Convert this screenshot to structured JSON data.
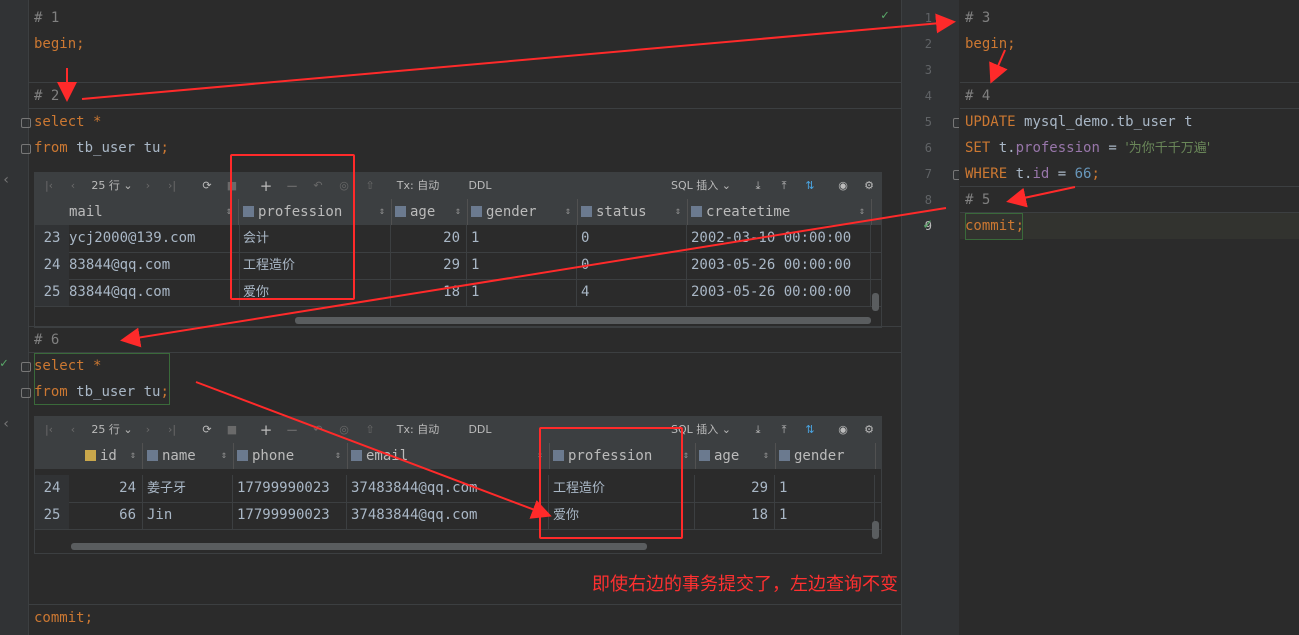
{
  "left_editor": {
    "blocks": [
      {
        "comment": "# 1",
        "lines": [
          [
            "begin",
            ";"
          ]
        ]
      },
      {
        "comment": "# 2"
      },
      {
        "comment": "# 6"
      }
    ],
    "c1": "# 1",
    "begin": "begin;",
    "c2": "# 2",
    "select_kw": "select",
    "select_star": "*",
    "from_kw": "from",
    "from_table": "tb_user tu",
    ";": ";",
    "c6": "# 6",
    "commit": "commit;"
  },
  "right_editor": {
    "line_numbers": [
      "1",
      "2",
      "3",
      "4",
      "5",
      "6",
      "7",
      "8",
      "9"
    ],
    "c3": "# 3",
    "begin": "begin;",
    "c4": "# 4",
    "update_kw": "UPDATE",
    "update_target": "mysql_demo.tb_user t",
    "set_kw": "SET",
    "set_field_prefix": "t.",
    "set_field": "profession",
    "eq": " = ",
    "set_value": "'为你千千万遍'",
    "where_kw": "WHERE",
    "where_prefix": "t.",
    "where_field": "id",
    "where_val": "66",
    "c5": "# 5",
    "commit": "commit;"
  },
  "toolbar": {
    "rows_label": "25 行 ⌄",
    "tx_label": "Tx: 自动 ⌄",
    "ddl_label": "DDL",
    "sql_insert_label": "SQL 插入 ⌄"
  },
  "grid1": {
    "columns": [
      "mail",
      "profession",
      "age",
      "gender",
      "status",
      "createtime"
    ],
    "rows": [
      {
        "num": "23",
        "mail": "ycj2000@139.com",
        "profession": "会计",
        "age": "20",
        "gender": "1",
        "status": "0",
        "createtime": "2002-03-10 00:00:00"
      },
      {
        "num": "24",
        "mail": "83844@qq.com",
        "profession": "工程造价",
        "age": "29",
        "gender": "1",
        "status": "0",
        "createtime": "2003-05-26 00:00:00"
      },
      {
        "num": "25",
        "mail": "83844@qq.com",
        "profession": "爱你",
        "age": "18",
        "gender": "1",
        "status": "4",
        "createtime": "2003-05-26 00:00:00"
      }
    ]
  },
  "grid2": {
    "columns": [
      "id",
      "name",
      "phone",
      "email",
      "profession",
      "age",
      "gender"
    ],
    "rows": [
      {
        "num": "24",
        "id": "24",
        "name": "姜子牙",
        "phone": "17799990023",
        "email": "37483844@qq.com",
        "profession": "工程造价",
        "age": "29",
        "gender": "1"
      },
      {
        "num": "25",
        "id": "66",
        "name": "Jin",
        "phone": "17799990023",
        "email": "37483844@qq.com",
        "profession": "爱你",
        "age": "18",
        "gender": "1"
      }
    ]
  },
  "annotation": "即使右边的事务提交了，左边查询不变",
  "colors": {
    "annotation_red": "#ff2a2a",
    "keyword": "#cc7832",
    "string": "#6a8759",
    "number": "#6897bb"
  }
}
